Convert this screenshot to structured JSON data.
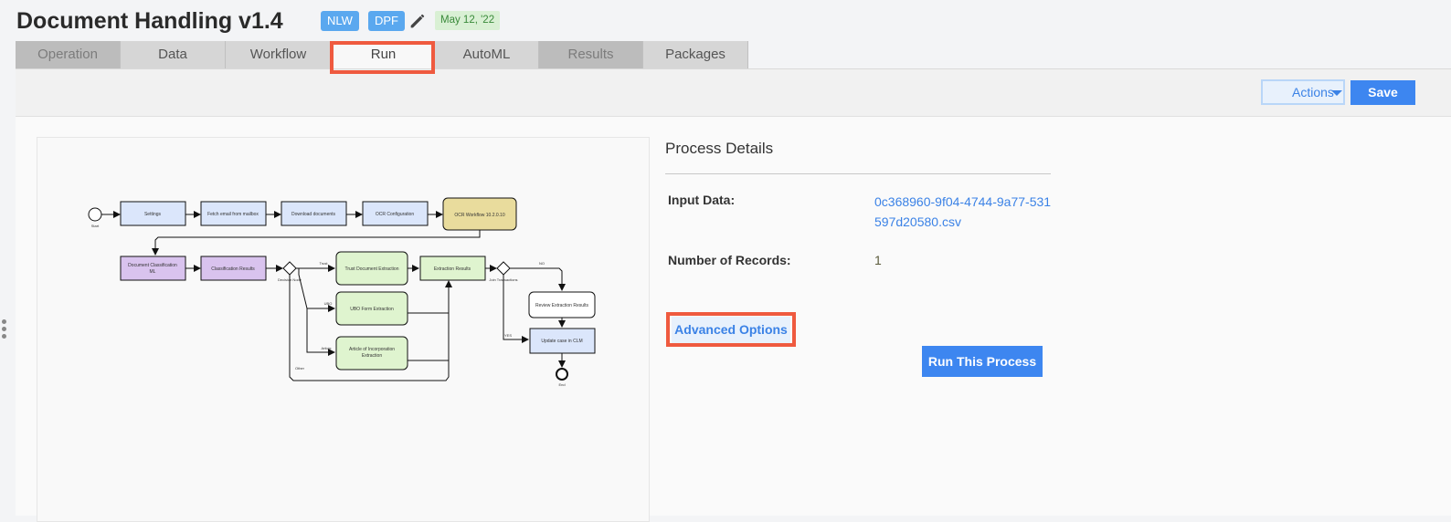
{
  "header": {
    "title": "Document Handling v1.4",
    "badges": [
      "NLW",
      "DPF"
    ],
    "date": "May 12, '22"
  },
  "tabs": [
    {
      "label": "Operation",
      "state": "disabled"
    },
    {
      "label": "Data",
      "state": "normal"
    },
    {
      "label": "Workflow",
      "state": "normal"
    },
    {
      "label": "Run",
      "state": "active"
    },
    {
      "label": "AutoML",
      "state": "normal"
    },
    {
      "label": "Results",
      "state": "disabled"
    },
    {
      "label": "Packages",
      "state": "normal"
    }
  ],
  "toolbar": {
    "actions_label": "Actions",
    "save_label": "Save"
  },
  "diagram": {
    "start_label": "Start",
    "end_label": "End",
    "nodes": {
      "settings": "Settings",
      "fetch_email": "Fetch email from mailbox",
      "download": "Download documents",
      "ocr_config": "OCR Configuration",
      "ocr_workflow": "OCR Workflow 10.2.0.10",
      "doc_class_1": "Document Classification",
      "doc_class_2": "ML",
      "class_results": "Classification Results",
      "trust_doc": "Trust Document Extraction",
      "ubo_form": "UBO Form Extraction",
      "article_1": "Article of Incorporation",
      "article_2": "Extraction",
      "extraction_results": "Extraction Results",
      "review": "Review Extraction Results",
      "update_clm": "Update case in CLM"
    },
    "edge_labels": {
      "decision": "Decision Node",
      "trust": "Trust",
      "ubo": "UBO",
      "article": "Article",
      "other": "Other",
      "join": "Join Transactions",
      "no": "NO",
      "yes": "YES"
    }
  },
  "details": {
    "title": "Process Details",
    "input_label": "Input Data:",
    "input_value": "0c368960-9f04-4744-9a77-531597d20580.csv",
    "records_label": "Number of Records:",
    "records_value": "1",
    "advanced_label": "Advanced Options",
    "run_label": "Run This Process"
  },
  "colors": {
    "accent": "#3d86f0",
    "highlight": "#ef5a3f",
    "badge": "#5aa8ef",
    "date_badge_bg": "#d9f0d4",
    "task_blue": "#dbe6fb",
    "task_green": "#dff4cf",
    "task_purple": "#d9c3ee",
    "task_gold": "#e9dc9d"
  },
  "icons": [
    "edit-icon",
    "chevron-down-icon",
    "drag-handle-icon"
  ]
}
